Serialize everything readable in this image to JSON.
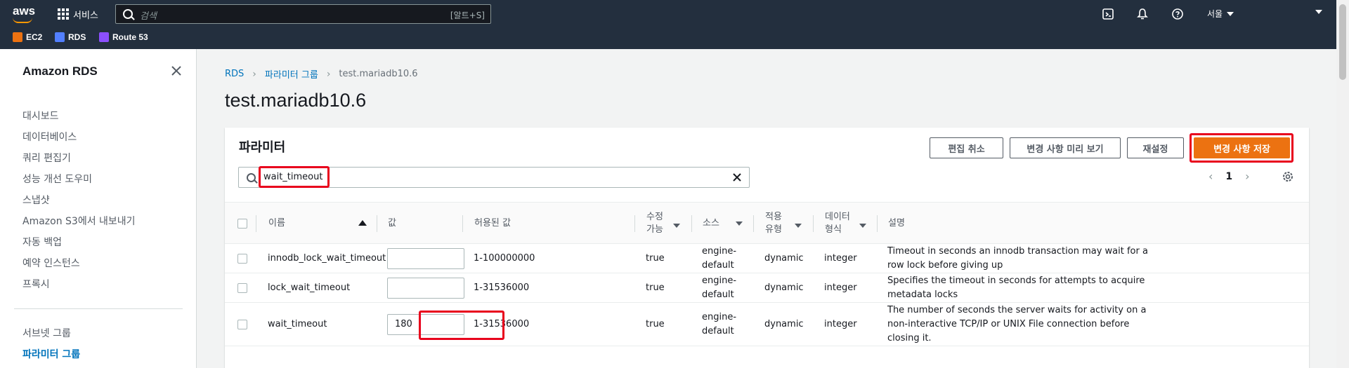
{
  "topbar": {
    "logo": "aws",
    "services_label": "서비스",
    "search_placeholder": "검색",
    "search_shortcut": "[알트+S]",
    "region_label": "서울",
    "favorites": [
      {
        "label": "EC2",
        "color": "#ec7211"
      },
      {
        "label": "RDS",
        "color": "#527fff"
      },
      {
        "label": "Route 53",
        "color": "#8c4fff"
      }
    ]
  },
  "sidebar": {
    "title": "Amazon RDS",
    "items": [
      {
        "label": "대시보드"
      },
      {
        "label": "데이터베이스"
      },
      {
        "label": "쿼리 편집기"
      },
      {
        "label": "성능 개선 도우미"
      },
      {
        "label": "스냅샷"
      },
      {
        "label": "Amazon S3에서 내보내기"
      },
      {
        "label": "자동 백업"
      },
      {
        "label": "예약 인스턴스"
      },
      {
        "label": "프록시"
      }
    ],
    "items2": [
      {
        "label": "서브넷 그룹"
      },
      {
        "label": "파라미터 그룹"
      }
    ]
  },
  "breadcrumb": {
    "items": [
      "RDS",
      "파라미터 그룹",
      "test.mariadb10.6"
    ]
  },
  "page_title": "test.mariadb10.6",
  "panel": {
    "title": "파라미터",
    "buttons": {
      "cancel": "편집 취소",
      "preview": "변경 사항 미리 보기",
      "reset": "재설정",
      "save": "변경 사항 저장"
    },
    "filter_value": "wait_timeout",
    "page_number": "1",
    "columns": {
      "name": "이름",
      "value": "값",
      "allowed": "허용된 값",
      "modifiable_1": "수정",
      "modifiable_2": "가능",
      "source": "소스",
      "apply_1": "적용",
      "apply_2": "유형",
      "dtype_1": "데이터",
      "dtype_2": "형식",
      "desc": "설명"
    },
    "rows": [
      {
        "name": "innodb_lock_wait_timeout",
        "value": "",
        "allowed": "1-100000000",
        "modifiable": "true",
        "source_1": "engine-",
        "source_2": "default",
        "apply": "dynamic",
        "dtype": "integer",
        "desc_1": "Timeout in seconds an innodb transaction may wait for a",
        "desc_2": "row lock before giving up",
        "desc_3": ""
      },
      {
        "name": "lock_wait_timeout",
        "value": "",
        "allowed": "1-31536000",
        "modifiable": "true",
        "source_1": "engine-",
        "source_2": "default",
        "apply": "dynamic",
        "dtype": "integer",
        "desc_1": "Specifies the timeout in seconds for attempts to acquire",
        "desc_2": "metadata locks",
        "desc_3": ""
      },
      {
        "name": "wait_timeout",
        "value": "180",
        "allowed": "1-31536000",
        "modifiable": "true",
        "source_1": "engine-",
        "source_2": "default",
        "apply": "dynamic",
        "dtype": "integer",
        "desc_1": "The number of seconds the server waits for activity on a",
        "desc_2": "non-interactive TCP/IP or UNIX File connection before",
        "desc_3": "closing it."
      }
    ]
  }
}
